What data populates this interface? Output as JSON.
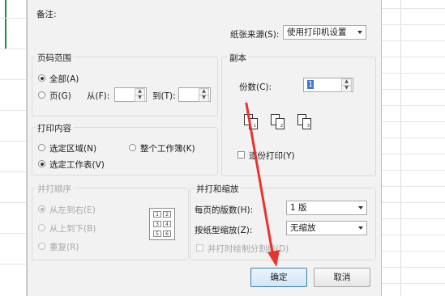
{
  "remark_label": "备注:",
  "paper_source": {
    "label": "纸张来源(S):",
    "value": "使用打印机设置"
  },
  "page_range": {
    "title": "页码范围",
    "all_label": "全部(A)",
    "pages_label": "页(G)",
    "from_label": "从(F):",
    "to_label": "到(T):",
    "from_value": "",
    "to_value": ""
  },
  "copies": {
    "title": "副本",
    "count_label": "份数(C):",
    "count_value": "1",
    "collate_label": "逐份打印(Y)",
    "page_nums": [
      "1",
      "2",
      "3"
    ]
  },
  "print_content": {
    "title": "打印内容",
    "selection_label": "选定区域(N)",
    "whole_workbook_label": "整个工作簿(K)",
    "selected_sheets_label": "选定工作表(V)"
  },
  "collate_order": {
    "title": "并打顺序",
    "left_to_right": "从左到右(E)",
    "top_to_bottom": "从上到下(B)",
    "repeat": "重复(R)",
    "grid_nums": [
      "1",
      "2",
      "3",
      "4",
      "5",
      "6"
    ]
  },
  "zoom": {
    "title": "并打和缩放",
    "pages_per_sheet_label": "每页的版数(H):",
    "pages_per_sheet_value": "1 版",
    "scale_label": "按纸型缩放(Z):",
    "scale_value": "无缩放",
    "draw_borders_label": "并打时绘制分割线(D)"
  },
  "buttons": {
    "ok": "确定",
    "cancel": "取消"
  },
  "annotation_color": "#e8332f"
}
